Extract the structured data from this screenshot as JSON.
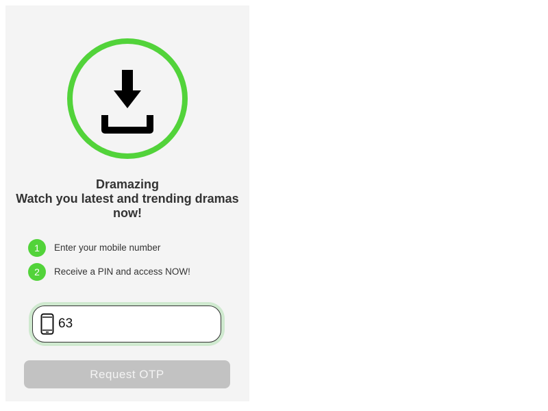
{
  "hero": {
    "icon": "download-icon",
    "ring_color": "#52d33a"
  },
  "title": {
    "line1": "Dramazing",
    "line2": "Watch you latest and trending dramas",
    "line3": "now!"
  },
  "steps": [
    {
      "number": "1",
      "text": "Enter your mobile number"
    },
    {
      "number": "2",
      "text": "Receive a PIN and access NOW!"
    }
  ],
  "phone": {
    "icon": "mobile-phone-icon",
    "value": "63"
  },
  "button": {
    "label": "Request OTP"
  },
  "colors": {
    "accent": "#52d33a",
    "button_disabled": "#c2c2c2",
    "panel_bg": "#f4f4f4"
  }
}
